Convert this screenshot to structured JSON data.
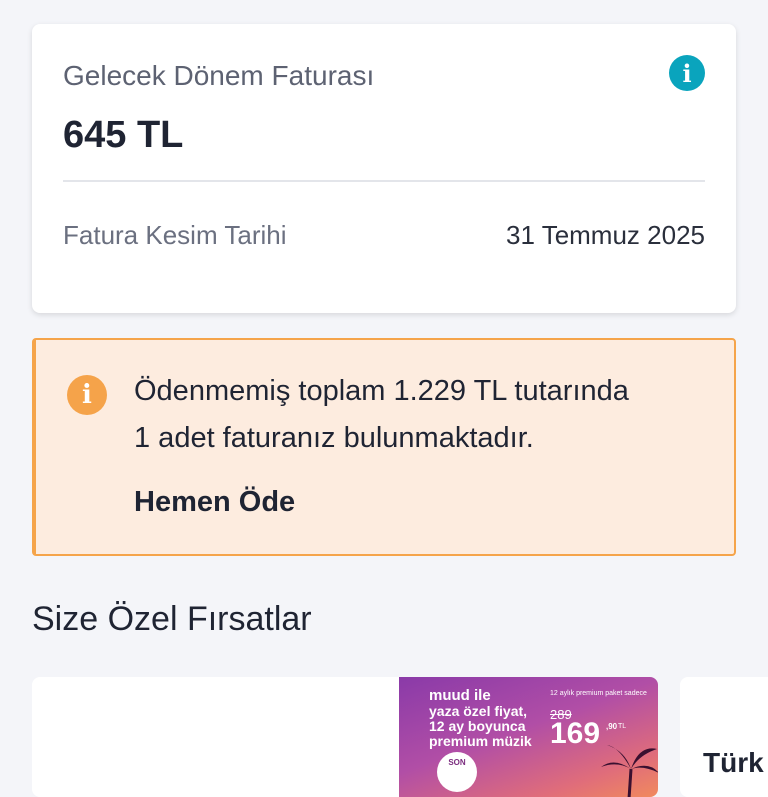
{
  "bill": {
    "title": "Gelecek Dönem Faturası",
    "amount": "645 TL",
    "cut_label": "Fatura Kesim Tarihi",
    "cut_date": "31 Temmuz 2025",
    "info_icon": "info-icon"
  },
  "warning": {
    "line1": "Ödenmemiş toplam 1.229 TL tutarında",
    "line2": "1 adet faturanız bulunmaktadır.",
    "action": "Hemen Öde",
    "icon": "warning-icon"
  },
  "offers": {
    "title": "Size Özel Fırsatlar",
    "banner": {
      "brand": "muud ile",
      "line1": "yaza özel fiyat,",
      "line2": "12 ay boyunca",
      "line3": "premium müzik",
      "top_note": "12 aylık premium paket sadece",
      "old_price": "289",
      "price": "169",
      "cents": ",90",
      "currency": "TL",
      "badge": "SON"
    },
    "second_title": "Türk"
  },
  "colors": {
    "accent_info": "#0aa4bd",
    "warning_orange": "#f5a34a",
    "warning_bg": "#fdecdf"
  }
}
